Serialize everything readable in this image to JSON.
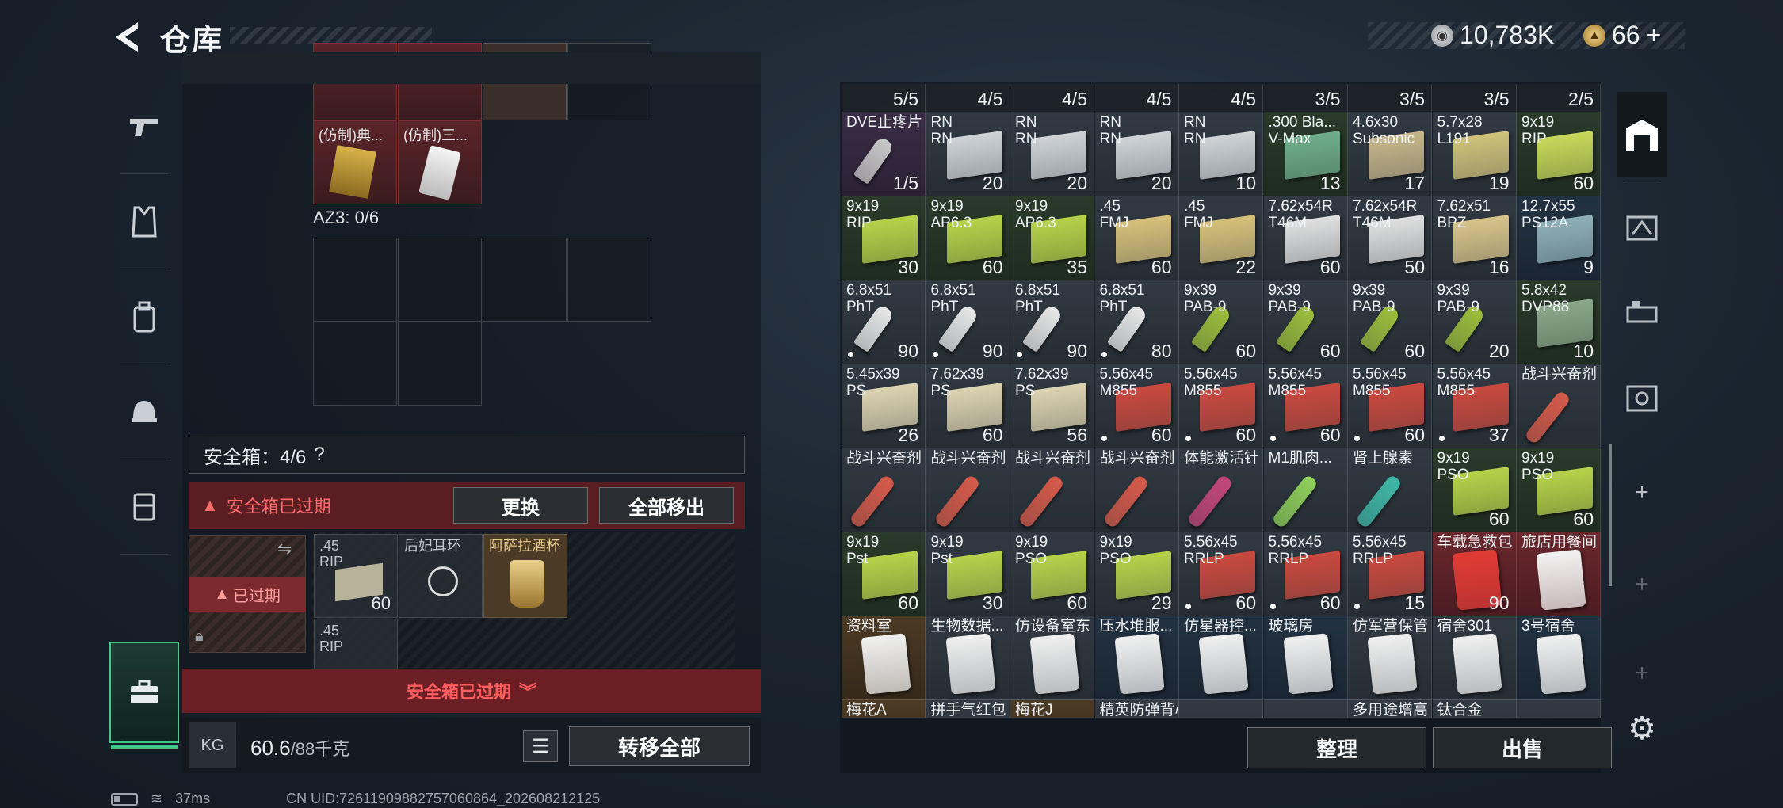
{
  "header": {
    "title": "仓库",
    "silver_amount": "10,783K",
    "gold_amount": "66",
    "gold_plus": "+"
  },
  "left_nav": [
    {
      "icon": "pistol-icon"
    },
    {
      "icon": "armor-vest-icon"
    },
    {
      "icon": "backpack-icon"
    },
    {
      "icon": "helmet-icon"
    },
    {
      "icon": "chest-rig-icon"
    },
    {
      "icon": "toolbox-icon"
    }
  ],
  "left_panel": {
    "top_items": [
      {
        "label": "(仿制)典..."
      },
      {
        "label": "(仿制)三..."
      }
    ],
    "az3_label": "AZ3: 0/6",
    "safe_box_label": "安全箱：4/6",
    "safe_box_help": "?",
    "expired_warning": "安全箱已过期",
    "replace_button": "更换",
    "remove_all_button": "全部移出",
    "safe_expired_tag": "已过期",
    "safe_items": [
      {
        "label": ".45\nRIP",
        "count": "60"
      },
      {
        "label": "后妃耳环",
        "count": ""
      },
      {
        "label": "阿萨拉酒杯",
        "count": ""
      },
      {
        "label": ".45\nRIP",
        "count": ""
      }
    ],
    "bottom_expired": "安全箱已过期",
    "weight_value": "60.6",
    "weight_max": "/88千克",
    "weight_unit_icon": "KG",
    "transfer_all_button": "转移全部"
  },
  "status_bar": {
    "ping": "37ms",
    "uid": "CN UID:72611909882757060864_202608212125"
  },
  "stash": {
    "header_counts": [
      "5/5",
      "4/5",
      "4/5",
      "4/5",
      "4/5",
      "3/5",
      "3/5",
      "3/5",
      "2/5"
    ],
    "rows": [
      [
        {
          "name": "DVE止疼片",
          "count": "1/5",
          "bg": "purple",
          "art": "#c9c9c9",
          "kind": "shell"
        },
        {
          "name": "RN\nRN",
          "count": "20",
          "bg": "gray",
          "art": "#cfd3d6"
        },
        {
          "name": "RN\nRN",
          "count": "20",
          "bg": "gray",
          "art": "#cfd3d6"
        },
        {
          "name": "RN\nRN",
          "count": "20",
          "bg": "gray",
          "art": "#cfd3d6"
        },
        {
          "name": "RN\nRN",
          "count": "10",
          "bg": "gray",
          "art": "#cfd3d6"
        },
        {
          "name": ".300 Bla...\nV-Max",
          "count": "13",
          "bg": "green",
          "art": "#6fae8b"
        },
        {
          "name": "4.6x30\nSubsonic",
          "count": "17",
          "bg": "gray",
          "art": "#c6b68a"
        },
        {
          "name": "5.7x28\nL191",
          "count": "19",
          "bg": "gray",
          "art": "#d0c27a"
        },
        {
          "name": "9x19\nRIP",
          "count": "60",
          "bg": "green",
          "art": "#c8d85a"
        }
      ],
      [
        {
          "name": "9x19\nRIP",
          "count": "30",
          "bg": "green",
          "art": "#b6d24a"
        },
        {
          "name": "9x19\nAP6.3",
          "count": "60",
          "bg": "green",
          "art": "#b6d24a"
        },
        {
          "name": "9x19\nAP6.3",
          "count": "35",
          "bg": "green",
          "art": "#b6d24a"
        },
        {
          "name": ".45\nFMJ",
          "count": "60",
          "bg": "gray",
          "art": "#d6c07a"
        },
        {
          "name": ".45\nFMJ",
          "count": "22",
          "bg": "gray",
          "art": "#d6c07a"
        },
        {
          "name": "7.62x54R\nT46M",
          "count": "60",
          "bg": "gray",
          "art": "#e0e0e0"
        },
        {
          "name": "7.62x54R\nT46M",
          "count": "50",
          "bg": "gray",
          "art": "#e0e0e0"
        },
        {
          "name": "7.62x51\nBPZ",
          "count": "16",
          "bg": "gray",
          "art": "#d8c48a"
        },
        {
          "name": "12.7x55\nPS12A",
          "count": "9",
          "bg": "blue",
          "art": "#8fb0b8"
        }
      ],
      [
        {
          "name": "6.8x51\nPhT",
          "count": "90",
          "bg": "gray",
          "art": "#e8e8e8",
          "kind": "shell",
          "dot": true
        },
        {
          "name": "6.8x51\nPhT",
          "count": "90",
          "bg": "gray",
          "art": "#e8e8e8",
          "kind": "shell",
          "dot": true
        },
        {
          "name": "6.8x51\nPhT",
          "count": "90",
          "bg": "gray",
          "art": "#e8e8e8",
          "kind": "shell",
          "dot": true
        },
        {
          "name": "6.8x51\nPhT",
          "count": "80",
          "bg": "gray",
          "art": "#e8e8e8",
          "kind": "shell",
          "dot": true
        },
        {
          "name": "9x39\nPAB-9",
          "count": "60",
          "bg": "gray",
          "art": "#9bbf3c",
          "kind": "shell"
        },
        {
          "name": "9x39\nPAB-9",
          "count": "60",
          "bg": "gray",
          "art": "#9bbf3c",
          "kind": "shell"
        },
        {
          "name": "9x39\nPAB-9",
          "count": "60",
          "bg": "gray",
          "art": "#9bbf3c",
          "kind": "shell"
        },
        {
          "name": "9x39\nPAB-9",
          "count": "20",
          "bg": "gray",
          "art": "#9bbf3c",
          "kind": "shell"
        },
        {
          "name": "5.8x42\nDVP88",
          "count": "10",
          "bg": "green",
          "art": "#8aa88a"
        }
      ],
      [
        {
          "name": "5.45x39\nPS",
          "count": "26",
          "bg": "gray",
          "art": "#dcd3b0"
        },
        {
          "name": "7.62x39\nPS",
          "count": "60",
          "bg": "gray",
          "art": "#dcd3b0"
        },
        {
          "name": "7.62x39\nPS",
          "count": "56",
          "bg": "gray",
          "art": "#dcd3b0"
        },
        {
          "name": "5.56x45\nM855",
          "count": "60",
          "bg": "gray",
          "art": "#c9493e",
          "dot": true
        },
        {
          "name": "5.56x45\nM855",
          "count": "60",
          "bg": "gray",
          "art": "#c9493e",
          "dot": true
        },
        {
          "name": "5.56x45\nM855",
          "count": "60",
          "bg": "gray",
          "art": "#c9493e",
          "dot": true
        },
        {
          "name": "5.56x45\nM855",
          "count": "60",
          "bg": "gray",
          "art": "#c9493e",
          "dot": true
        },
        {
          "name": "5.56x45\nM855",
          "count": "37",
          "bg": "gray",
          "art": "#c9493e",
          "dot": true
        },
        {
          "name": "战斗兴奋剂",
          "count": "",
          "bg": "gray",
          "art": "#d55a4a",
          "kind": "tube"
        }
      ],
      [
        {
          "name": "战斗兴奋剂",
          "count": "",
          "bg": "gray",
          "art": "#d55a4a",
          "kind": "tube"
        },
        {
          "name": "战斗兴奋剂",
          "count": "",
          "bg": "gray",
          "art": "#d55a4a",
          "kind": "tube"
        },
        {
          "name": "战斗兴奋剂",
          "count": "",
          "bg": "gray",
          "art": "#d55a4a",
          "kind": "tube"
        },
        {
          "name": "战斗兴奋剂",
          "count": "",
          "bg": "gray",
          "art": "#d55a4a",
          "kind": "tube"
        },
        {
          "name": "体能激活针",
          "count": "",
          "bg": "gray",
          "art": "#c4467a",
          "kind": "tube"
        },
        {
          "name": "M1肌肉...",
          "count": "",
          "bg": "gray",
          "art": "#8fd05a",
          "kind": "tube"
        },
        {
          "name": "肾上腺素",
          "count": "",
          "bg": "gray",
          "art": "#3fb8a8",
          "kind": "tube"
        },
        {
          "name": "9x19\nPSO",
          "count": "60",
          "bg": "green",
          "art": "#b6d24a"
        },
        {
          "name": "9x19\nPSO",
          "count": "60",
          "bg": "green",
          "art": "#b6d24a"
        }
      ],
      [
        {
          "name": "9x19\nPst",
          "count": "60",
          "bg": "green",
          "art": "#b6d24a"
        },
        {
          "name": "9x19\nPst",
          "count": "30",
          "bg": "gray",
          "art": "#b6d24a"
        },
        {
          "name": "9x19\nPSO",
          "count": "60",
          "bg": "gray",
          "art": "#b6d24a"
        },
        {
          "name": "9x19\nPSO",
          "count": "29",
          "bg": "gray",
          "art": "#b6d24a"
        },
        {
          "name": "5.56x45\nRRLP",
          "count": "60",
          "bg": "gray",
          "art": "#c9493e",
          "dot": true
        },
        {
          "name": "5.56x45\nRRLP",
          "count": "60",
          "bg": "gray",
          "art": "#c9493e",
          "dot": true
        },
        {
          "name": "5.56x45\nRRLP",
          "count": "15",
          "bg": "gray",
          "art": "#c9493e",
          "dot": true
        },
        {
          "name": "车载急救包",
          "count": "90",
          "bg": "red",
          "art": "#e23b35",
          "kind": "bag"
        },
        {
          "name": "旅店用餐间",
          "count": "",
          "bg": "red",
          "art": "#f2f2f2",
          "kind": "bag"
        }
      ],
      [
        {
          "name": "资料室",
          "count": "",
          "bg": "gold",
          "art": "#f0f0f0",
          "kind": "bag"
        },
        {
          "name": "生物数据...",
          "count": "",
          "bg": "gray",
          "art": "#f0f0f0",
          "kind": "bag"
        },
        {
          "name": "仿设备室东",
          "count": "",
          "bg": "gray",
          "art": "#f0f0f0",
          "kind": "bag"
        },
        {
          "name": "压水堆服...",
          "count": "",
          "bg": "blue",
          "art": "#f0f0f0",
          "kind": "bag"
        },
        {
          "name": "仿星器控...",
          "count": "",
          "bg": "blue",
          "art": "#f0f0f0",
          "kind": "bag"
        },
        {
          "name": "玻璃房",
          "count": "",
          "bg": "blue",
          "art": "#f0f0f0",
          "kind": "bag"
        },
        {
          "name": "仿军营保管",
          "count": "",
          "bg": "gray",
          "art": "#f0f0f0",
          "kind": "bag"
        },
        {
          "name": "宿舍301",
          "count": "",
          "bg": "gray",
          "art": "#f0f0f0",
          "kind": "bag"
        },
        {
          "name": "3号宿舍",
          "count": "",
          "bg": "blue",
          "art": "#f0f0f0",
          "kind": "bag"
        }
      ],
      [
        {
          "name": "梅花A",
          "count": "",
          "bg": "gold",
          "art": "#d04040"
        },
        {
          "name": "拼手气红包",
          "count": "",
          "bg": "gray",
          "art": "#d04040"
        },
        {
          "name": "梅花J",
          "count": "",
          "bg": "gold",
          "art": "#d04040"
        },
        {
          "name": "精英防弹背心",
          "count": "",
          "bg": "gray",
          "art": "#5a6470"
        },
        {
          "name": "",
          "count": "",
          "bg": "gray",
          "art": "#5a6470"
        },
        {
          "name": "",
          "count": "",
          "bg": "gray",
          "art": "#5a6470"
        },
        {
          "name": "多用途增高",
          "count": "",
          "bg": "gray",
          "art": "#5a6470"
        },
        {
          "name": "钛合金",
          "count": "",
          "bg": "gray",
          "art": "#5a6470"
        },
        {
          "name": "",
          "count": "",
          "bg": "gray",
          "art": "#5a6470"
        }
      ]
    ],
    "sort_button": "整理",
    "sell_button": "出售"
  },
  "right_nav": [
    {
      "icon": "warehouse-icon"
    },
    {
      "icon": "gti-storage-1-icon"
    },
    {
      "icon": "gti-storage-2-icon"
    },
    {
      "icon": "vault-icon"
    },
    {
      "icon": "add-storage-icon",
      "label": "+"
    },
    {
      "icon": "add-storage-icon",
      "label": "+"
    },
    {
      "icon": "add-storage-icon",
      "label": "+"
    }
  ],
  "settings_icon": "gear-icon"
}
